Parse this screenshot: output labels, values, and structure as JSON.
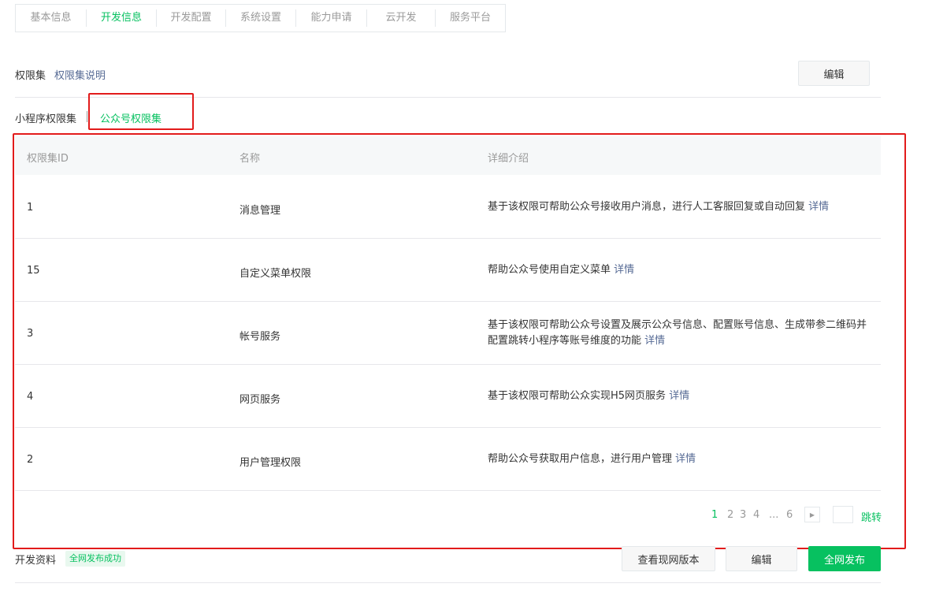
{
  "tabs": [
    {
      "label": "基本信息",
      "active": false
    },
    {
      "label": "开发信息",
      "active": true
    },
    {
      "label": "开发配置",
      "active": false
    },
    {
      "label": "系统设置",
      "active": false
    },
    {
      "label": "能力申请",
      "active": false
    },
    {
      "label": "云开发",
      "active": false
    },
    {
      "label": "服务平台",
      "active": false
    }
  ],
  "permission_section": {
    "title": "权限集",
    "link": "权限集说明",
    "edit_button": "编辑"
  },
  "subtabs": {
    "miniprogram": "小程序权限集",
    "official_account": "公众号权限集",
    "active": "official_account"
  },
  "table": {
    "headers": {
      "id": "权限集ID",
      "name": "名称",
      "desc": "详细介绍"
    },
    "detail_link": "详情",
    "rows": [
      {
        "id": "1",
        "name": "消息管理",
        "desc": "基于该权限可帮助公众号接收用户消息，进行人工客服回复或自动回复"
      },
      {
        "id": "15",
        "name": "自定义菜单权限",
        "desc": "帮助公众号使用自定义菜单"
      },
      {
        "id": "3",
        "name": "帐号服务",
        "desc": "基于该权限可帮助公众号设置及展示公众号信息、配置账号信息、生成带参二维码并配置跳转小程序等账号维度的功能"
      },
      {
        "id": "4",
        "name": "网页服务",
        "desc": "基于该权限可帮助公众实现H5网页服务"
      },
      {
        "id": "2",
        "name": "用户管理权限",
        "desc": "帮助公众号获取用户信息，进行用户管理"
      }
    ]
  },
  "pagination": {
    "pages": [
      "1",
      "2",
      "3",
      "4",
      "...",
      "6"
    ],
    "current": "1",
    "next_icon": "triangle-right-icon",
    "jump_input_value": "",
    "jump_label": "跳转"
  },
  "dev_section": {
    "title": "开发资料",
    "badge": "全网发布成功",
    "view_button": "查看现网版本",
    "edit_button": "编辑",
    "publish_button": "全网发布"
  },
  "colors": {
    "accent": "#07c160",
    "link": "#576b95",
    "highlight_box": "#e21b1b"
  }
}
